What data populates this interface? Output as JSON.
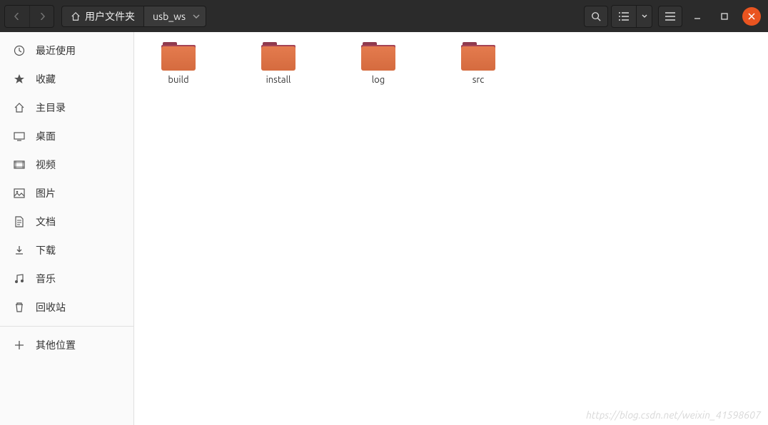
{
  "titlebar": {
    "breadcrumb": {
      "home_label": "用户文件夹",
      "current": "usb_ws"
    }
  },
  "sidebar": {
    "items": [
      {
        "icon": "clock",
        "label": "最近使用"
      },
      {
        "icon": "star",
        "label": "收藏"
      },
      {
        "icon": "home",
        "label": "主目录"
      },
      {
        "icon": "desktop",
        "label": "桌面"
      },
      {
        "icon": "video",
        "label": "视频"
      },
      {
        "icon": "image",
        "label": "图片"
      },
      {
        "icon": "document",
        "label": "文档"
      },
      {
        "icon": "download",
        "label": "下载"
      },
      {
        "icon": "music",
        "label": "音乐"
      },
      {
        "icon": "trash",
        "label": "回收站"
      }
    ],
    "other_label": "其他位置"
  },
  "main": {
    "folders": [
      {
        "name": "build"
      },
      {
        "name": "install"
      },
      {
        "name": "log"
      },
      {
        "name": "src"
      }
    ]
  },
  "watermark": "https://blog.csdn.net/weixin_41598607"
}
